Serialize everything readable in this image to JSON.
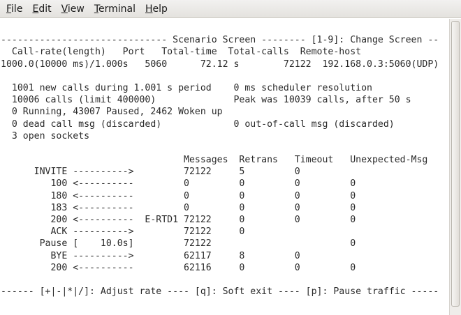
{
  "menubar": {
    "items": [
      {
        "mnemonic": "F",
        "rest": "ile"
      },
      {
        "mnemonic": "E",
        "rest": "dit"
      },
      {
        "mnemonic": "V",
        "rest": "iew"
      },
      {
        "mnemonic": "T",
        "rest": "erminal"
      },
      {
        "mnemonic": "H",
        "rest": "elp"
      }
    ]
  },
  "terminal": {
    "lines": [
      "",
      "------------------------------ Scenario Screen -------- [1-9]: Change Screen --",
      "  Call-rate(length)   Port   Total-time  Total-calls  Remote-host",
      "1000.0(10000 ms)/1.000s   5060      72.12 s        72122  192.168.0.3:5060(UDP)",
      "",
      "  1001 new calls during 1.001 s period    0 ms scheduler resolution",
      "  10006 calls (limit 400000)              Peak was 10039 calls, after 50 s",
      "  0 Running, 43007 Paused, 2462 Woken up",
      "  0 dead call msg (discarded)             0 out-of-call msg (discarded)",
      "  3 open sockets",
      "",
      "                                 Messages  Retrans   Timeout   Unexpected-Msg",
      "      INVITE ---------->         72122     5         0",
      "         100 <----------         0         0         0         0",
      "         180 <----------         0         0         0         0",
      "         183 <----------         0         0         0         0",
      "         200 <----------  E-RTD1 72122     0         0         0",
      "         ACK ---------->         72122     0",
      "       Pause [    10.0s]         72122                         0",
      "         BYE ---------->         62117     8         0",
      "         200 <----------         62116     0         0         0",
      "",
      "------ [+|-|*|/]: Adjust rate ---- [q]: Soft exit ---- [p]: Pause traffic -----"
    ]
  }
}
